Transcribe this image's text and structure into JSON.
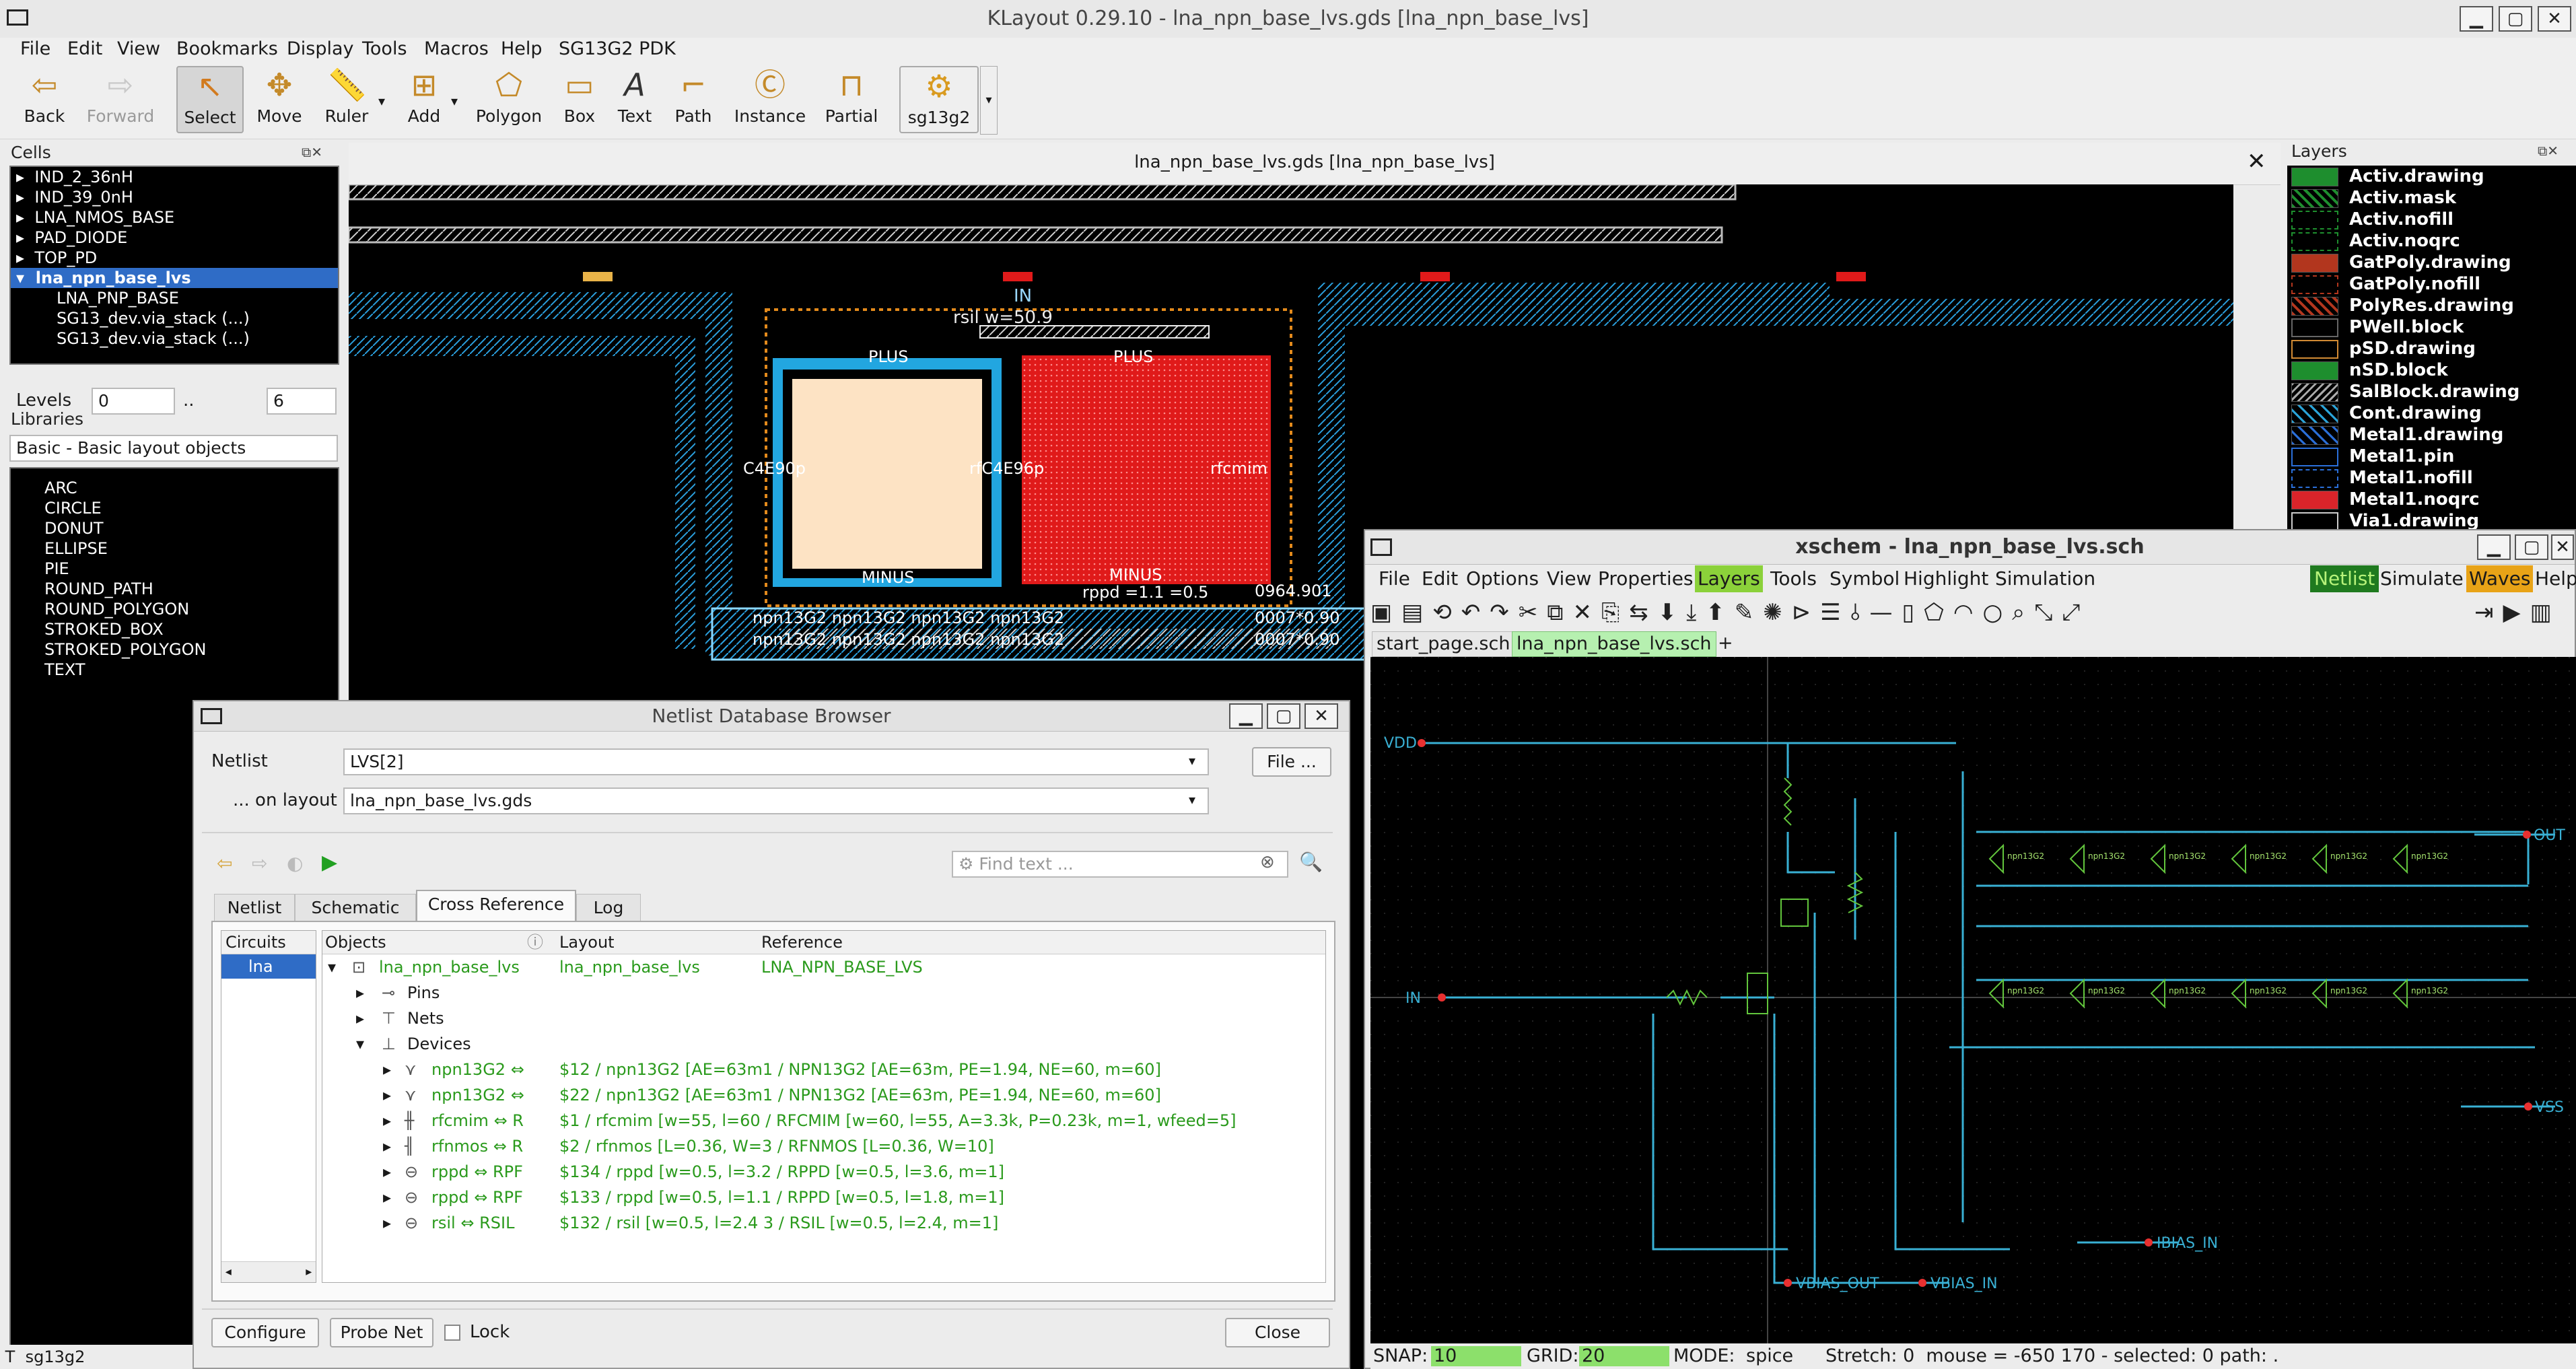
{
  "klayout": {
    "title": "KLayout 0.29.10 - lna_npn_base_lvs.gds [lna_npn_base_lvs]",
    "menu": [
      "File",
      "Edit",
      "View",
      "Bookmarks",
      "Display",
      "Tools",
      "Macros",
      "Help",
      "SG13G2 PDK"
    ],
    "toolbar": [
      {
        "label": "Back",
        "icon": "back-arrow-icon"
      },
      {
        "label": "Forward",
        "icon": "forward-arrow-icon"
      },
      {
        "label": "Select",
        "icon": "select-cursor-icon"
      },
      {
        "label": "Move",
        "icon": "move-icon"
      },
      {
        "label": "Ruler",
        "icon": "ruler-icon"
      },
      {
        "label": "Add",
        "icon": "add-icon"
      },
      {
        "label": "Polygon",
        "icon": "polygon-icon"
      },
      {
        "label": "Box",
        "icon": "box-icon"
      },
      {
        "label": "Text",
        "icon": "text-icon"
      },
      {
        "label": "Path",
        "icon": "path-icon"
      },
      {
        "label": "Instance",
        "icon": "instance-icon"
      },
      {
        "label": "Partial",
        "icon": "partial-icon"
      },
      {
        "label": "sg13g2",
        "icon": "sg13g2-icon"
      }
    ],
    "cells": {
      "title": "Cells",
      "items": [
        "IND_2_36nH",
        "IND_39_0nH",
        "LNA_NMOS_BASE",
        "PAD_DIODE",
        "TOP_PD",
        "lna_npn_base_lvs",
        "LNA_PNP_BASE",
        "SG13_dev.via_stack (...)",
        "SG13_dev.via_stack (...)"
      ],
      "selected": "lna_npn_base_lvs"
    },
    "levels": {
      "label": "Levels",
      "from": "0",
      "sep": "..",
      "to": "6"
    },
    "libraries": {
      "title": "Libraries",
      "selected": "Basic - Basic layout objects",
      "items": [
        "ARC",
        "CIRCLE",
        "DONUT",
        "ELLIPSE",
        "PIE",
        "ROUND_PATH",
        "ROUND_POLYGON",
        "STROKED_BOX",
        "STROKED_POLYGON",
        "TEXT"
      ]
    },
    "layout_tab": "lna_npn_base_lvs.gds [lna_npn_base_lvs]",
    "canvas_labels": {
      "in": "IN",
      "rsil": "rsil w=50.9",
      "plus1": "PLUS",
      "plus2": "PLUS",
      "minus1": "MINUS",
      "minus2": "MINUS",
      "c4e9": "C4E90p",
      "rfc": "rfC4E96p",
      "rfcmim": "rfcmim",
      "rppd": "rppd =1.1 =0.5",
      "num": "0964.901",
      "npn1": "npn13G2 npn13G2 npn13G2 npn13G2",
      "npn2": "npn13G2 npn13G2 npn13G2 npn13G2",
      "r1": "0007*0.90",
      "r2": "0007*0.90"
    },
    "layers": {
      "title": "Layers",
      "items": [
        {
          "name": "Activ.drawing",
          "color": "#1e8e2e"
        },
        {
          "name": "Activ.mask",
          "color": "#1e8e2e"
        },
        {
          "name": "Activ.nofill",
          "color": "#1e8e2e"
        },
        {
          "name": "Activ.noqrc",
          "color": "#1e8e2e"
        },
        {
          "name": "GatPoly.drawing",
          "color": "#b2361e"
        },
        {
          "name": "GatPoly.nofill",
          "color": "#b2361e"
        },
        {
          "name": "PolyRes.drawing",
          "color": "#b2361e"
        },
        {
          "name": "PWell.block",
          "color": "#666666"
        },
        {
          "name": "pSD.drawing",
          "color": "#d18a34"
        },
        {
          "name": "nSD.block",
          "color": "#1e8e2e"
        },
        {
          "name": "SalBlock.drawing",
          "color": "#aaaaaa"
        },
        {
          "name": "Cont.drawing",
          "color": "#2aa4d9"
        },
        {
          "name": "Metal1.drawing",
          "color": "#2a6fd9"
        },
        {
          "name": "Metal1.pin",
          "color": "#2a6fd9"
        },
        {
          "name": "Metal1.nofill",
          "color": "#2a6fd9"
        },
        {
          "name": "Metal1.noqrc",
          "color": "#d9242a"
        },
        {
          "name": "Via1.drawing",
          "color": "#cccccc"
        }
      ]
    },
    "status": {
      "label": "T",
      "value": "sg13g2"
    }
  },
  "netlist_browser": {
    "title": "Netlist Database Browser",
    "netlist_label": "Netlist",
    "netlist_value": "LVS[2]",
    "file_button": "File ...",
    "layout_label": "... on layout",
    "layout_value": "lna_npn_base_lvs.gds",
    "find_placeholder": "Find text ...",
    "tabs": [
      "Netlist",
      "Schematic",
      "Cross Reference",
      "Log"
    ],
    "active_tab": "Cross Reference",
    "columns": {
      "circuits": "Circuits",
      "objects": "Objects",
      "layout": "Layout",
      "reference": "Reference"
    },
    "circuit_item": "lna",
    "root": {
      "object": "lna_npn_base_lvs",
      "layout": "lna_npn_base_lvs",
      "reference": "LNA_NPN_BASE_LVS"
    },
    "groups": [
      "Pins",
      "Nets",
      "Devices"
    ],
    "devices": [
      {
        "obj": "npn13G2 ⇔",
        "detail": "$12 / npn13G2 [AE=63m1 / NPN13G2 [AE=63m, PE=1.94, NE=60, m=60]"
      },
      {
        "obj": "npn13G2 ⇔",
        "detail": "$22 / npn13G2 [AE=63m1 / NPN13G2 [AE=63m, PE=1.94, NE=60, m=60]"
      },
      {
        "obj": "rfcmim ⇔ R",
        "detail": "$1 / rfcmim [w=55, l=60 / RFCMIM [w=60, l=55, A=3.3k, P=0.23k, m=1, wfeed=5]"
      },
      {
        "obj": "rfnmos ⇔ R",
        "detail": "$2 / rfnmos [L=0.36, W=3 / RFNMOS [L=0.36, W=10]"
      },
      {
        "obj": "rppd ⇔ RPF",
        "detail": "$134 / rppd [w=0.5, l=3.2 / RPPD [w=0.5, l=3.6, m=1]"
      },
      {
        "obj": "rppd ⇔ RPF",
        "detail": "$133 / rppd [w=0.5, l=1.1 / RPPD [w=0.5, l=1.8, m=1]"
      },
      {
        "obj": "rsil ⇔ RSIL",
        "detail": "$132 / rsil [w=0.5, l=2.4 3 / RSIL [w=0.5, l=2.4, m=1]"
      }
    ],
    "buttons": {
      "configure": "Configure",
      "probe": "Probe Net",
      "lock": "Lock",
      "close": "Close"
    }
  },
  "xschem": {
    "title": "xschem - lna_npn_base_lvs.sch",
    "menu": [
      "File",
      "Edit",
      "Options",
      "View",
      "Properties",
      "Layers",
      "Tools",
      "Symbol",
      "Highlight",
      "Simulation"
    ],
    "right_menu": [
      "Netlist",
      "Simulate",
      "Waves",
      "Help"
    ],
    "tabs": [
      "start_page.sch",
      "lna_npn_base_lvs.sch",
      "+"
    ],
    "active_tab": "lna_npn_base_lvs.sch",
    "pins": {
      "vdd": "VDD",
      "in": "IN",
      "out": "OUT",
      "vss": "VSS",
      "vbias_out": "VBIAS_OUT",
      "vbias_in": "VBIAS_IN",
      "ibias_in": "IBIAS_IN"
    },
    "device_label": "npn13G2",
    "status": {
      "snap_label": "SNAP:",
      "snap": "10",
      "grid_label": "GRID:",
      "grid": "20",
      "mode_label": "MODE:",
      "mode": "spice",
      "rest": "Stretch: 0  mouse = -650 170 - selected: 0 path: ."
    }
  }
}
